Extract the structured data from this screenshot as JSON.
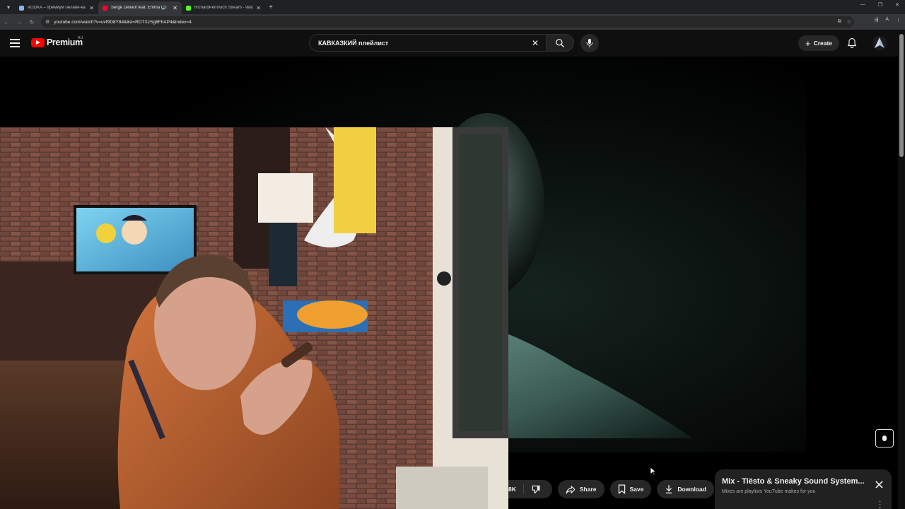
{
  "browser": {
    "tabs": [
      {
        "title": "VODKA – премиум онлайн-ка",
        "favicon_color": "#8ab4f8",
        "active": false
      },
      {
        "title": "Serge Devant feat. Emma H",
        "favicon_color": "#ff0033",
        "active": true
      },
      {
        "title": "RichardPetrovich Stream - Wat",
        "favicon_color": "#53fc18",
        "active": false
      }
    ],
    "url": "youtube.com/watch?v=uvf9D8Y84&list=RDTXzSg6FhAP4&index=4"
  },
  "masthead": {
    "logo_text": "Premium",
    "country_code": "RU",
    "search_query": "КАВКАЗКИЙ плейлист",
    "create_label": "Create"
  },
  "actions": {
    "likes_count": "8K",
    "share_label": "Share",
    "save_label": "Save",
    "download_label": "Download"
  },
  "mix_panel": {
    "title": "Mix - Tiësto & Sneaky Sound System...",
    "subtitle": "Mixes are playlists YouTube makes for you"
  },
  "colors": {
    "background": "#0f0f0f",
    "brand_red": "#ff0000",
    "pill": "#272727"
  }
}
